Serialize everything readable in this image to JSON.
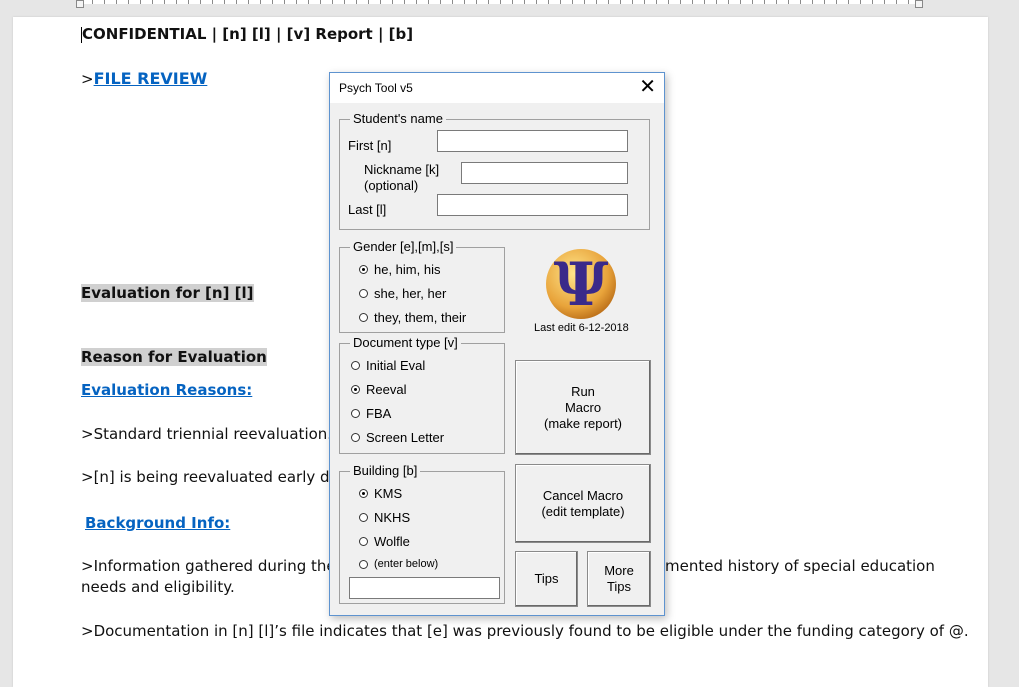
{
  "document": {
    "header": "CONFIDENTIAL | [n] [l] | [v] Report | [b]",
    "file_review_prefix": ">",
    "file_review_link": "FILE REVIEW",
    "evaluation_for": "Evaluation for [n] [l]",
    "reason_heading": "Reason for Evaluation",
    "evaluation_reasons": "Evaluation Reasons:",
    "standard_triennial": ">Standard triennial reevaluation.",
    "reevaluated_early": ">[n] is being reevaluated early due",
    "background_info": "Background Info:",
    "info_gathered_a": ">Information gathered during the c",
    "info_gathered_b": "mented history of special education",
    "needs_eligibility": "needs and eligibility.",
    "documentation": ">Documentation in [n] [l]’s file indicates that [e] was previously found to be eligible under the funding category of @."
  },
  "dialog": {
    "title": "Psych Tool v5",
    "close_glyph": "✕",
    "students_name": {
      "label": "Student's name",
      "first_label": "First [n]",
      "first_value": "",
      "nickname_label": "Nickname [k]",
      "nickname_sub": "(optional)",
      "nickname_value": "",
      "last_label": "Last [l]",
      "last_value": ""
    },
    "gender": {
      "label": "Gender [e],[m],[s]",
      "options": [
        "he, him, his",
        "she, her, her",
        "they, them, their"
      ],
      "selected": 0
    },
    "document_type": {
      "label": "Document type [v]",
      "options": [
        "Initial Eval",
        "Reeval",
        "FBA",
        "Screen Letter"
      ],
      "selected": 1
    },
    "building": {
      "label": "Building [b]",
      "options": [
        "KMS",
        "NKHS",
        "Wolfle",
        "(enter below)"
      ],
      "selected": 0,
      "other_value": ""
    },
    "logo_glyph": "Ψ",
    "last_edit": "Last edit 6-12-2018",
    "buttons": {
      "run": "Run\nMacro\n(make report)",
      "cancel": "Cancel Macro\n(edit template)",
      "tips": "Tips",
      "more_tips": "More\nTips"
    }
  },
  "colors": {
    "link_blue": "#0563c1",
    "dialog_border": "#5e93cf",
    "logo_purple": "#3a2a8a"
  }
}
